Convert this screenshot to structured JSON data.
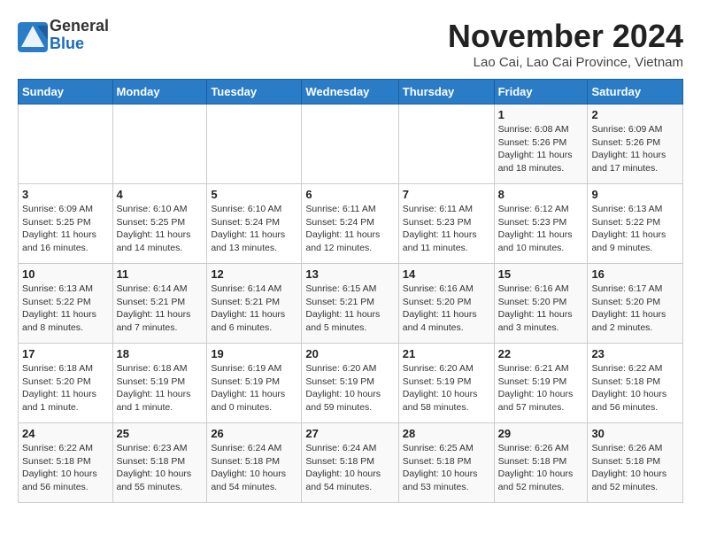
{
  "header": {
    "logo": {
      "line1": "General",
      "line2": "Blue"
    },
    "title": "November 2024",
    "location": "Lao Cai, Lao Cai Province, Vietnam"
  },
  "weekdays": [
    "Sunday",
    "Monday",
    "Tuesday",
    "Wednesday",
    "Thursday",
    "Friday",
    "Saturday"
  ],
  "weeks": [
    [
      {
        "day": "",
        "info": ""
      },
      {
        "day": "",
        "info": ""
      },
      {
        "day": "",
        "info": ""
      },
      {
        "day": "",
        "info": ""
      },
      {
        "day": "",
        "info": ""
      },
      {
        "day": "1",
        "info": "Sunrise: 6:08 AM\nSunset: 5:26 PM\nDaylight: 11 hours and 18 minutes."
      },
      {
        "day": "2",
        "info": "Sunrise: 6:09 AM\nSunset: 5:26 PM\nDaylight: 11 hours and 17 minutes."
      }
    ],
    [
      {
        "day": "3",
        "info": "Sunrise: 6:09 AM\nSunset: 5:25 PM\nDaylight: 11 hours and 16 minutes."
      },
      {
        "day": "4",
        "info": "Sunrise: 6:10 AM\nSunset: 5:25 PM\nDaylight: 11 hours and 14 minutes."
      },
      {
        "day": "5",
        "info": "Sunrise: 6:10 AM\nSunset: 5:24 PM\nDaylight: 11 hours and 13 minutes."
      },
      {
        "day": "6",
        "info": "Sunrise: 6:11 AM\nSunset: 5:24 PM\nDaylight: 11 hours and 12 minutes."
      },
      {
        "day": "7",
        "info": "Sunrise: 6:11 AM\nSunset: 5:23 PM\nDaylight: 11 hours and 11 minutes."
      },
      {
        "day": "8",
        "info": "Sunrise: 6:12 AM\nSunset: 5:23 PM\nDaylight: 11 hours and 10 minutes."
      },
      {
        "day": "9",
        "info": "Sunrise: 6:13 AM\nSunset: 5:22 PM\nDaylight: 11 hours and 9 minutes."
      }
    ],
    [
      {
        "day": "10",
        "info": "Sunrise: 6:13 AM\nSunset: 5:22 PM\nDaylight: 11 hours and 8 minutes."
      },
      {
        "day": "11",
        "info": "Sunrise: 6:14 AM\nSunset: 5:21 PM\nDaylight: 11 hours and 7 minutes."
      },
      {
        "day": "12",
        "info": "Sunrise: 6:14 AM\nSunset: 5:21 PM\nDaylight: 11 hours and 6 minutes."
      },
      {
        "day": "13",
        "info": "Sunrise: 6:15 AM\nSunset: 5:21 PM\nDaylight: 11 hours and 5 minutes."
      },
      {
        "day": "14",
        "info": "Sunrise: 6:16 AM\nSunset: 5:20 PM\nDaylight: 11 hours and 4 minutes."
      },
      {
        "day": "15",
        "info": "Sunrise: 6:16 AM\nSunset: 5:20 PM\nDaylight: 11 hours and 3 minutes."
      },
      {
        "day": "16",
        "info": "Sunrise: 6:17 AM\nSunset: 5:20 PM\nDaylight: 11 hours and 2 minutes."
      }
    ],
    [
      {
        "day": "17",
        "info": "Sunrise: 6:18 AM\nSunset: 5:20 PM\nDaylight: 11 hours and 1 minute."
      },
      {
        "day": "18",
        "info": "Sunrise: 6:18 AM\nSunset: 5:19 PM\nDaylight: 11 hours and 1 minute."
      },
      {
        "day": "19",
        "info": "Sunrise: 6:19 AM\nSunset: 5:19 PM\nDaylight: 11 hours and 0 minutes."
      },
      {
        "day": "20",
        "info": "Sunrise: 6:20 AM\nSunset: 5:19 PM\nDaylight: 10 hours and 59 minutes."
      },
      {
        "day": "21",
        "info": "Sunrise: 6:20 AM\nSunset: 5:19 PM\nDaylight: 10 hours and 58 minutes."
      },
      {
        "day": "22",
        "info": "Sunrise: 6:21 AM\nSunset: 5:19 PM\nDaylight: 10 hours and 57 minutes."
      },
      {
        "day": "23",
        "info": "Sunrise: 6:22 AM\nSunset: 5:18 PM\nDaylight: 10 hours and 56 minutes."
      }
    ],
    [
      {
        "day": "24",
        "info": "Sunrise: 6:22 AM\nSunset: 5:18 PM\nDaylight: 10 hours and 56 minutes."
      },
      {
        "day": "25",
        "info": "Sunrise: 6:23 AM\nSunset: 5:18 PM\nDaylight: 10 hours and 55 minutes."
      },
      {
        "day": "26",
        "info": "Sunrise: 6:24 AM\nSunset: 5:18 PM\nDaylight: 10 hours and 54 minutes."
      },
      {
        "day": "27",
        "info": "Sunrise: 6:24 AM\nSunset: 5:18 PM\nDaylight: 10 hours and 54 minutes."
      },
      {
        "day": "28",
        "info": "Sunrise: 6:25 AM\nSunset: 5:18 PM\nDaylight: 10 hours and 53 minutes."
      },
      {
        "day": "29",
        "info": "Sunrise: 6:26 AM\nSunset: 5:18 PM\nDaylight: 10 hours and 52 minutes."
      },
      {
        "day": "30",
        "info": "Sunrise: 6:26 AM\nSunset: 5:18 PM\nDaylight: 10 hours and 52 minutes."
      }
    ]
  ]
}
